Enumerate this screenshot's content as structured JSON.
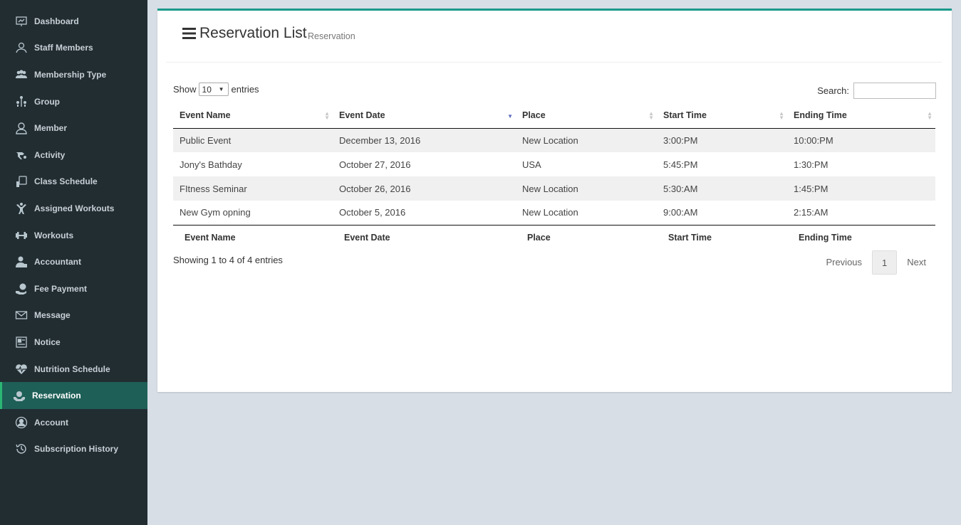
{
  "sidebar": {
    "items": [
      {
        "label": "Dashboard",
        "icon": "dashboard-icon"
      },
      {
        "label": "Staff Members",
        "icon": "staff-icon"
      },
      {
        "label": "Membership Type",
        "icon": "membership-icon"
      },
      {
        "label": "Group",
        "icon": "group-icon"
      },
      {
        "label": "Member",
        "icon": "member-icon"
      },
      {
        "label": "Activity",
        "icon": "activity-icon"
      },
      {
        "label": "Class Schedule",
        "icon": "class-schedule-icon"
      },
      {
        "label": "Assigned Workouts",
        "icon": "assigned-workouts-icon"
      },
      {
        "label": "Workouts",
        "icon": "workouts-icon"
      },
      {
        "label": "Accountant",
        "icon": "accountant-icon"
      },
      {
        "label": "Fee Payment",
        "icon": "fee-payment-icon"
      },
      {
        "label": "Message",
        "icon": "message-icon"
      },
      {
        "label": "Notice",
        "icon": "notice-icon"
      },
      {
        "label": "Nutrition Schedule",
        "icon": "nutrition-icon"
      },
      {
        "label": "Reservation",
        "icon": "reservation-icon",
        "active": true
      },
      {
        "label": "Account",
        "icon": "account-icon"
      },
      {
        "label": "Subscription History",
        "icon": "history-icon"
      }
    ]
  },
  "header": {
    "title": "Reservation List",
    "subtitle": "Reservation"
  },
  "controls": {
    "show_label": "Show",
    "entries_value": "10",
    "entries_label": "entries",
    "search_label": "Search:"
  },
  "table": {
    "columns": [
      "Event Name",
      "Event Date",
      "Place",
      "Start Time",
      "Ending Time"
    ],
    "rows": [
      [
        "Public Event",
        "December 13, 2016",
        "New Location",
        "3:00:PM",
        "10:00:PM"
      ],
      [
        "Jony's Bathday",
        "October 27, 2016",
        "USA",
        "5:45:PM",
        "1:30:PM"
      ],
      [
        "FItness Seminar",
        "October 26, 2016",
        "New Location",
        "5:30:AM",
        "1:45:PM"
      ],
      [
        "New Gym opning",
        "October 5, 2016",
        "New Location",
        "9:00:AM",
        "2:15:AM"
      ]
    ]
  },
  "footer": {
    "info": "Showing 1 to 4 of 4 entries",
    "previous": "Previous",
    "page": "1",
    "next": "Next"
  },
  "colors": {
    "sidebar_bg": "#222d32",
    "active_bg": "#1e5f57",
    "accent": "#1a9a8a",
    "page_bg": "#d8dee6"
  }
}
